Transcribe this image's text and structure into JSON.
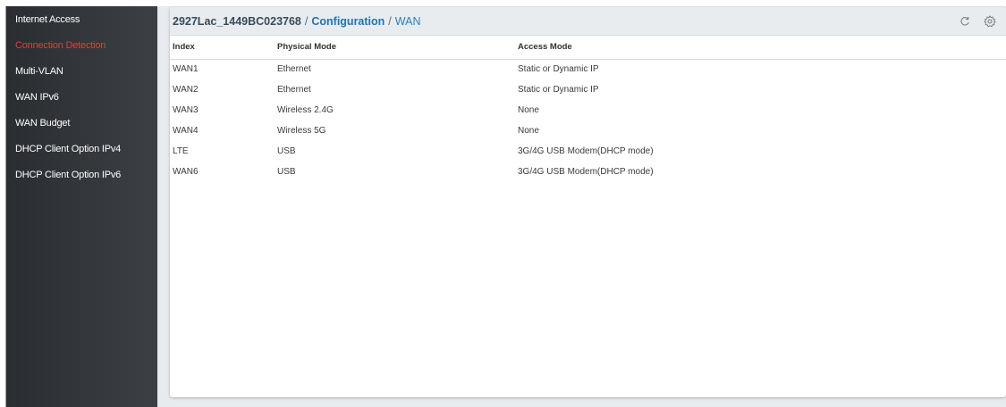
{
  "sidebar": {
    "items": [
      {
        "label": "Internet Access",
        "active": false
      },
      {
        "label": "Connection Detection",
        "active": true
      },
      {
        "label": "Multi-VLAN",
        "active": false
      },
      {
        "label": "WAN IPv6",
        "active": false
      },
      {
        "label": "WAN Budget",
        "active": false
      },
      {
        "label": "DHCP Client Option IPv4",
        "active": false
      },
      {
        "label": "DHCP Client Option IPv6",
        "active": false
      }
    ]
  },
  "header": {
    "device": "2927Lac_1449BC023768",
    "separator": "/",
    "section": "Configuration",
    "page": "WAN",
    "icons": [
      "refresh-icon",
      "gear-icon"
    ]
  },
  "table": {
    "columns": [
      "Index",
      "Physical Mode",
      "Access Mode"
    ],
    "rows": [
      [
        "WAN1",
        "Ethernet",
        "Static or Dynamic IP"
      ],
      [
        "WAN2",
        "Ethernet",
        "Static or Dynamic IP"
      ],
      [
        "WAN3",
        "Wireless 2.4G",
        "None"
      ],
      [
        "WAN4",
        "Wireless 5G",
        "None"
      ],
      [
        "LTE",
        "USB",
        "3G/4G USB Modem(DHCP mode)"
      ],
      [
        "WAN6",
        "USB",
        "3G/4G USB Modem(DHCP mode)"
      ]
    ]
  },
  "colors": {
    "active_item": "#e0403a",
    "config_link": "#1f73b7",
    "sidebar_bg": "#2a2d31"
  }
}
